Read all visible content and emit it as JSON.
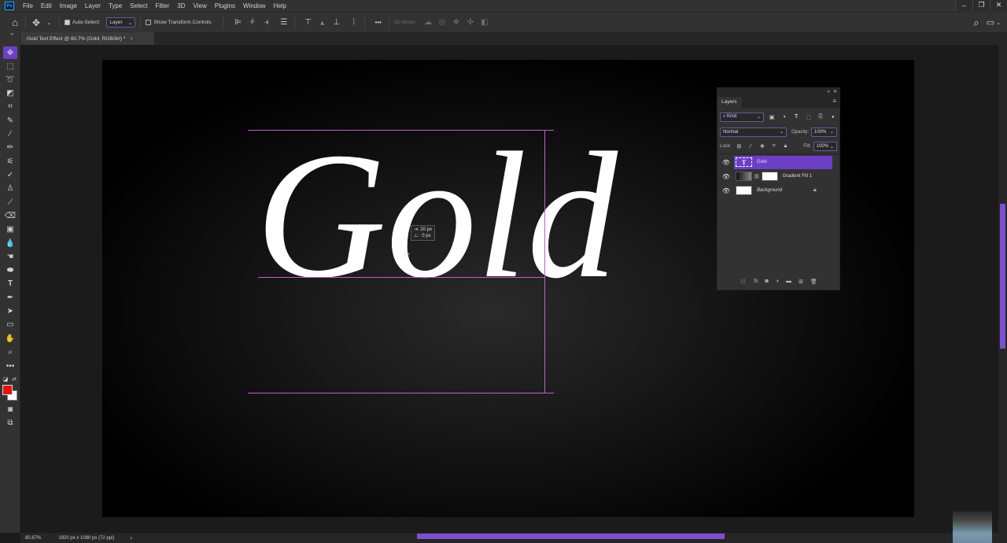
{
  "app": {
    "logo": "Ps",
    "accent_color": "#6d3fc6",
    "guide_color": "#c25dcf"
  },
  "menu": [
    "File",
    "Edit",
    "Image",
    "Layer",
    "Type",
    "Select",
    "Filter",
    "3D",
    "View",
    "Plugins",
    "Window",
    "Help"
  ],
  "window_controls": {
    "minimize": "–",
    "restore": "❐",
    "close": "✕"
  },
  "options_bar": {
    "home_icon": "⌂",
    "move_icon": "✥",
    "auto_select_label": "Auto-Select:",
    "auto_select_checked": true,
    "auto_select_target": "Layer",
    "show_transform_label": "Show Transform Controls",
    "show_transform_checked": false,
    "more_label": "•••",
    "mode_3d_label": "3D Mode:",
    "search_icon": "⌕",
    "workspace_icon": "▭"
  },
  "document_tab": {
    "title": "Gold Text Effect @ 80.7% (Gold, RGB/8#) *",
    "close": "×"
  },
  "canvas": {
    "text": "Gold",
    "measure": {
      "horizontal": "20 px",
      "vertical": "0 px"
    }
  },
  "tools": [
    "move",
    "marquee",
    "lasso",
    "object-select",
    "crop",
    "eyedropper",
    "healing",
    "brush",
    "clone-stamp",
    "history-brush",
    "eraser",
    "gradient",
    "blur",
    "dodge",
    "sponge",
    "type",
    "pen",
    "path-select",
    "rectangle",
    "hand",
    "zoom",
    "more"
  ],
  "colors": {
    "foreground": "#e0120f",
    "background": "#ffffff"
  },
  "layers_panel": {
    "title": "Layers",
    "filter_kind": "Kind",
    "blend_mode": "Normal",
    "opacity_label": "Opacity:",
    "opacity_value": "100%",
    "lock_label": "Lock:",
    "fill_label": "Fill:",
    "fill_value": "100%",
    "layers": [
      {
        "name": "Gold",
        "type": "text",
        "visible": true,
        "selected": true
      },
      {
        "name": "Gradient Fill 1",
        "type": "gradient-fill",
        "visible": true,
        "selected": false
      },
      {
        "name": "Background",
        "type": "background",
        "visible": true,
        "selected": false,
        "locked": true
      }
    ]
  },
  "status": {
    "zoom": "80.67%",
    "doc_size": "1920 px x 1080 px (72 ppi)",
    "arrow": "›"
  }
}
